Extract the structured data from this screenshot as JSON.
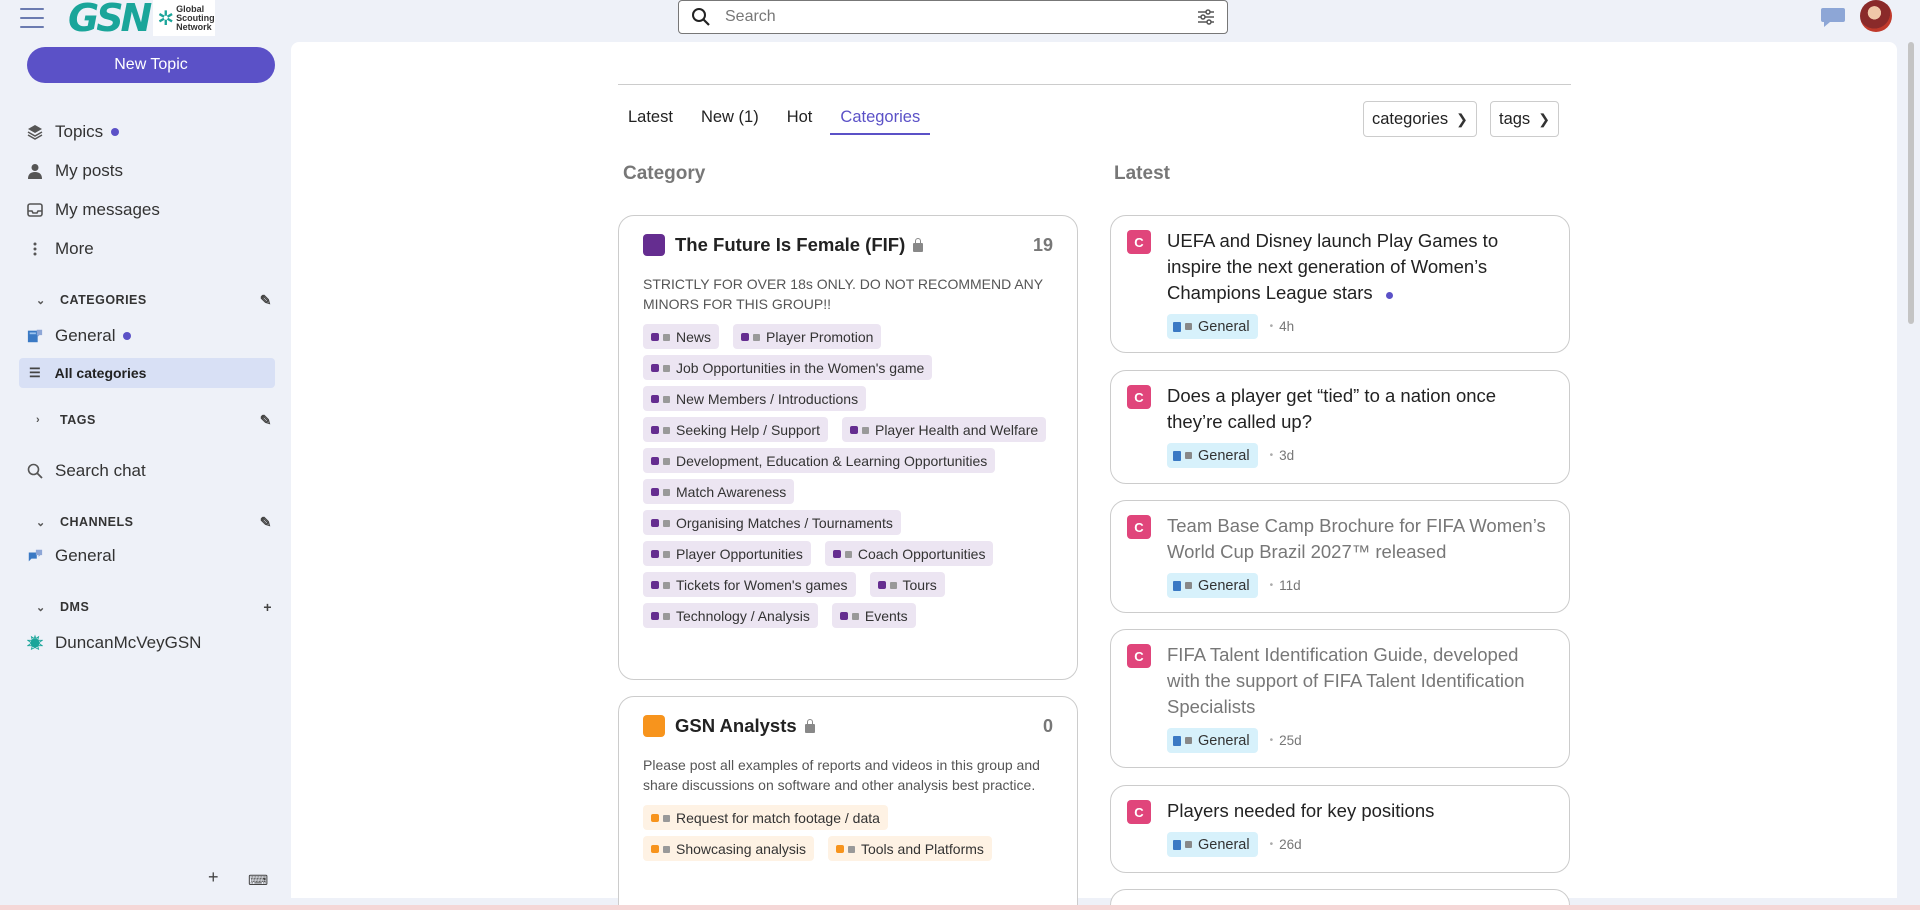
{
  "header": {
    "logo_text": "GSN",
    "logo_subtitle_1": "Global",
    "logo_subtitle_2": "Scouting",
    "logo_subtitle_3": "Network",
    "search_placeholder": "Search"
  },
  "sidebar": {
    "new_topic": "New Topic",
    "nav": [
      {
        "label": "Topics",
        "icon": "layers-icon"
      },
      {
        "label": "My posts",
        "icon": "user-icon"
      },
      {
        "label": "My messages",
        "icon": "inbox-icon"
      },
      {
        "label": "More",
        "icon": "more-vertical-icon"
      }
    ],
    "categories_header": "CATEGORIES",
    "categories": [
      {
        "label": "General"
      }
    ],
    "all_categories": "All categories",
    "tags_header": "TAGS",
    "search_chat": "Search chat",
    "channels_header": "CHANNELS",
    "channels": [
      {
        "label": "General"
      }
    ],
    "dms_header": "DMS",
    "dms": [
      {
        "label": "DuncanMcVeyGSN"
      }
    ]
  },
  "main": {
    "tabs": [
      {
        "label": "Latest"
      },
      {
        "label": "New (1)"
      },
      {
        "label": "Hot"
      },
      {
        "label": "Categories"
      }
    ],
    "categories_dropdown": "categories",
    "tags_dropdown": "tags",
    "category_heading": "Category",
    "latest_heading": "Latest",
    "category_cards": [
      {
        "title": "The Future Is Female (FIF)",
        "count": "19",
        "color": "#652d90",
        "description": "STRICTLY FOR OVER 18s ONLY. DO NOT RECOMMEND ANY MINORS FOR THIS GROUP!!",
        "subcategories": [
          "News",
          "Player Promotion",
          "Job Opportunities in the Women's game",
          "New Members / Introductions",
          "Seeking Help / Support",
          "Player Health and Welfare",
          "Development, Education & Learning Opportunities",
          "Match Awareness",
          "Organising Matches / Tournaments",
          "Player Opportunities",
          "Coach Opportunities",
          "Tickets for Women's games",
          "Tours",
          "Technology / Analysis",
          "Events"
        ]
      },
      {
        "title": "GSN Analysts",
        "count": "0",
        "color": "#f7941d",
        "description": "Please post all examples of reports and videos in this group and share discussions on software and other analysis best practice.",
        "subcategories": [
          "Request for match footage / data",
          "Showcasing analysis",
          "Tools and Platforms"
        ]
      }
    ],
    "latest_topics": [
      {
        "avatar": "C",
        "title": "UEFA and Disney launch Play Games to inspire the next generation of Women’s Champions League stars",
        "unread": true,
        "category": "General",
        "age": "4h"
      },
      {
        "avatar": "C",
        "title": "Does a player get “tied” to a nation once they’re called up?",
        "unread": false,
        "category": "General",
        "age": "3d"
      },
      {
        "avatar": "C",
        "title": "Team Base Camp Brochure for FIFA Women’s World Cup Brazil 2027™ released",
        "unread": false,
        "category": "General",
        "age": "11d"
      },
      {
        "avatar": "C",
        "title": "FIFA Talent Identification Guide, developed with the support of FIFA Talent Identification Specialists",
        "unread": false,
        "category": "General",
        "age": "25d"
      },
      {
        "avatar": "C",
        "title": "Players needed for key positions",
        "unread": false,
        "category": "General",
        "age": "26d"
      }
    ]
  }
}
